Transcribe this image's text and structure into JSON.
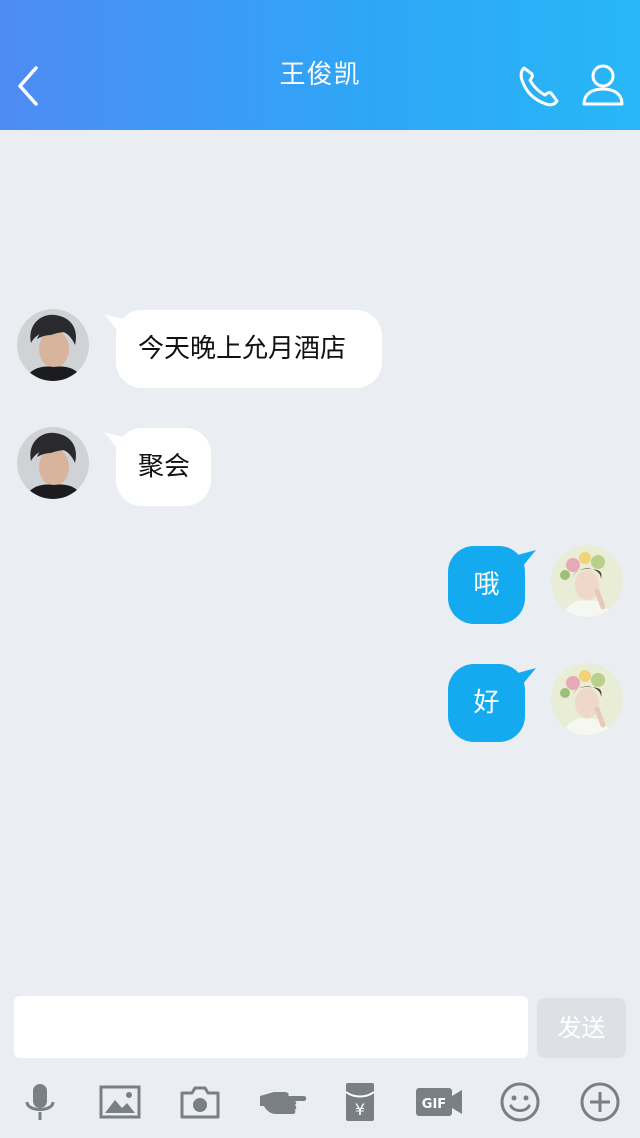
{
  "header": {
    "title": "王俊凯"
  },
  "messages": [
    {
      "direction": "incoming",
      "text": "今天晚上允月酒店"
    },
    {
      "direction": "incoming",
      "text": "聚会"
    },
    {
      "direction": "outgoing",
      "text": "哦"
    },
    {
      "direction": "outgoing",
      "text": "好"
    }
  ],
  "composer": {
    "input_value": "",
    "send_label": "发送"
  },
  "toolbar": {
    "icons": [
      "microphone-icon",
      "image-icon",
      "camera-icon",
      "poke-icon",
      "red-packet-icon",
      "gif-icon",
      "emoji-icon",
      "plus-icon"
    ]
  },
  "colors": {
    "header_gradient_start": "#4f8bf4",
    "header_gradient_end": "#27b7f7",
    "outgoing_bubble": "#14aaf0",
    "incoming_bubble": "#ffffff",
    "background": "#eaeef3"
  }
}
